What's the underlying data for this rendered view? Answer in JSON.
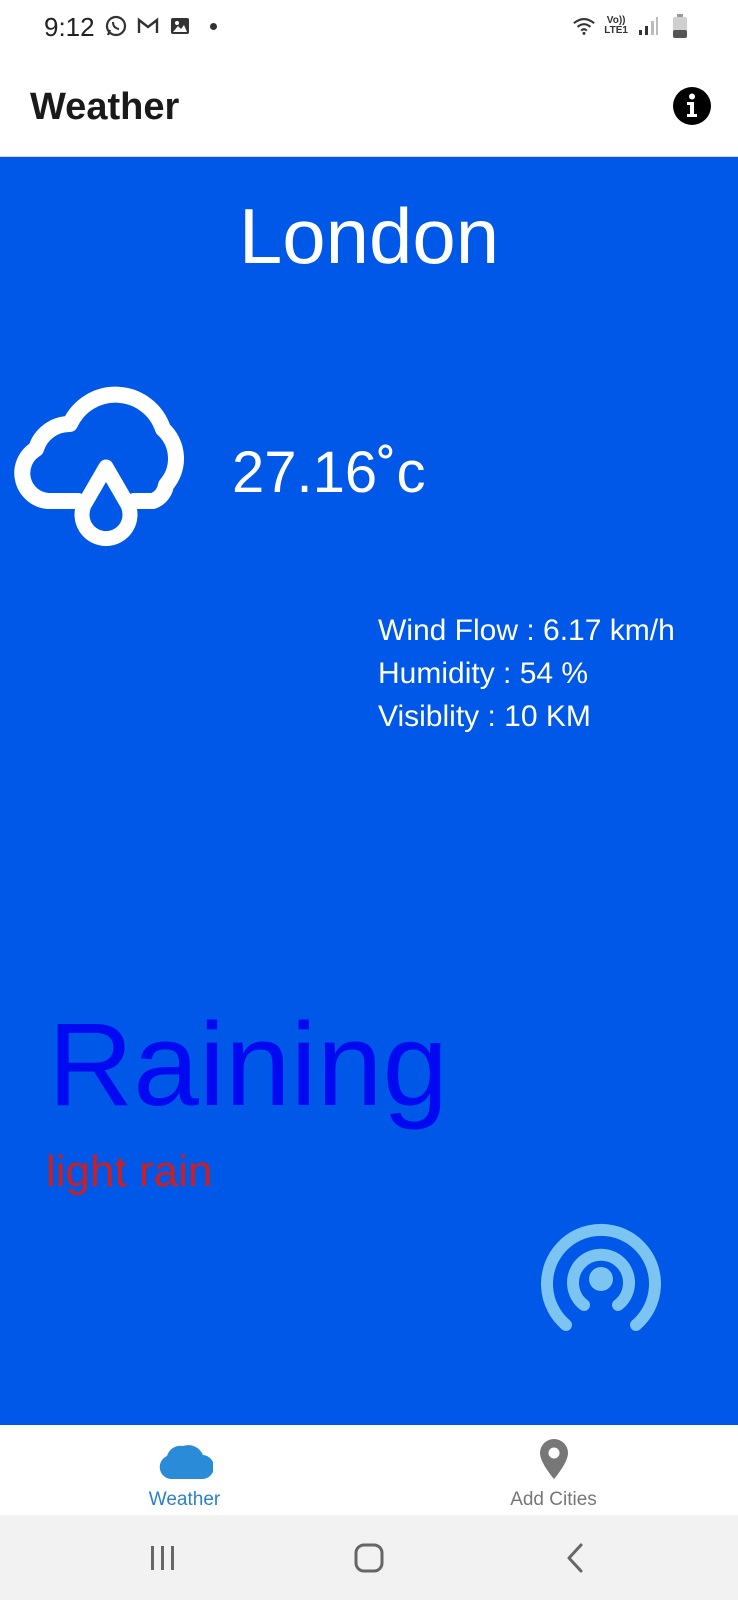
{
  "status_bar": {
    "time": "9:12",
    "left_icons": [
      "whatsapp-icon",
      "gmail-icon",
      "gallery-icon",
      "notification-dot"
    ],
    "right_icons": [
      "wifi-icon",
      "volte-lte-icon",
      "signal-icon",
      "battery-icon"
    ],
    "volte_top": "Vo))",
    "volte_bottom": "LTE1"
  },
  "app_bar": {
    "title": "Weather",
    "info_icon": "info-icon"
  },
  "weather": {
    "city": "London",
    "temperature": "27.16˚c",
    "details": [
      "Wind Flow : 6.17 km/h",
      "Humidity : 54 %",
      "Visiblity : 10 KM"
    ],
    "condition": "Raining",
    "description": "light rain",
    "colors": {
      "background": "#0058e8",
      "condition": "#0009f0",
      "description": "#cc1f22",
      "broadcast_icon": "#7cc4f2"
    }
  },
  "bottom_nav": {
    "items": [
      {
        "label": "Weather",
        "icon": "cloud-icon",
        "active": true
      },
      {
        "label": "Add Cities",
        "icon": "location-pin-icon",
        "active": false
      }
    ],
    "active_color": "#2a7fcf"
  },
  "system_nav": {
    "buttons": [
      "recents-button",
      "home-button",
      "back-button"
    ]
  }
}
